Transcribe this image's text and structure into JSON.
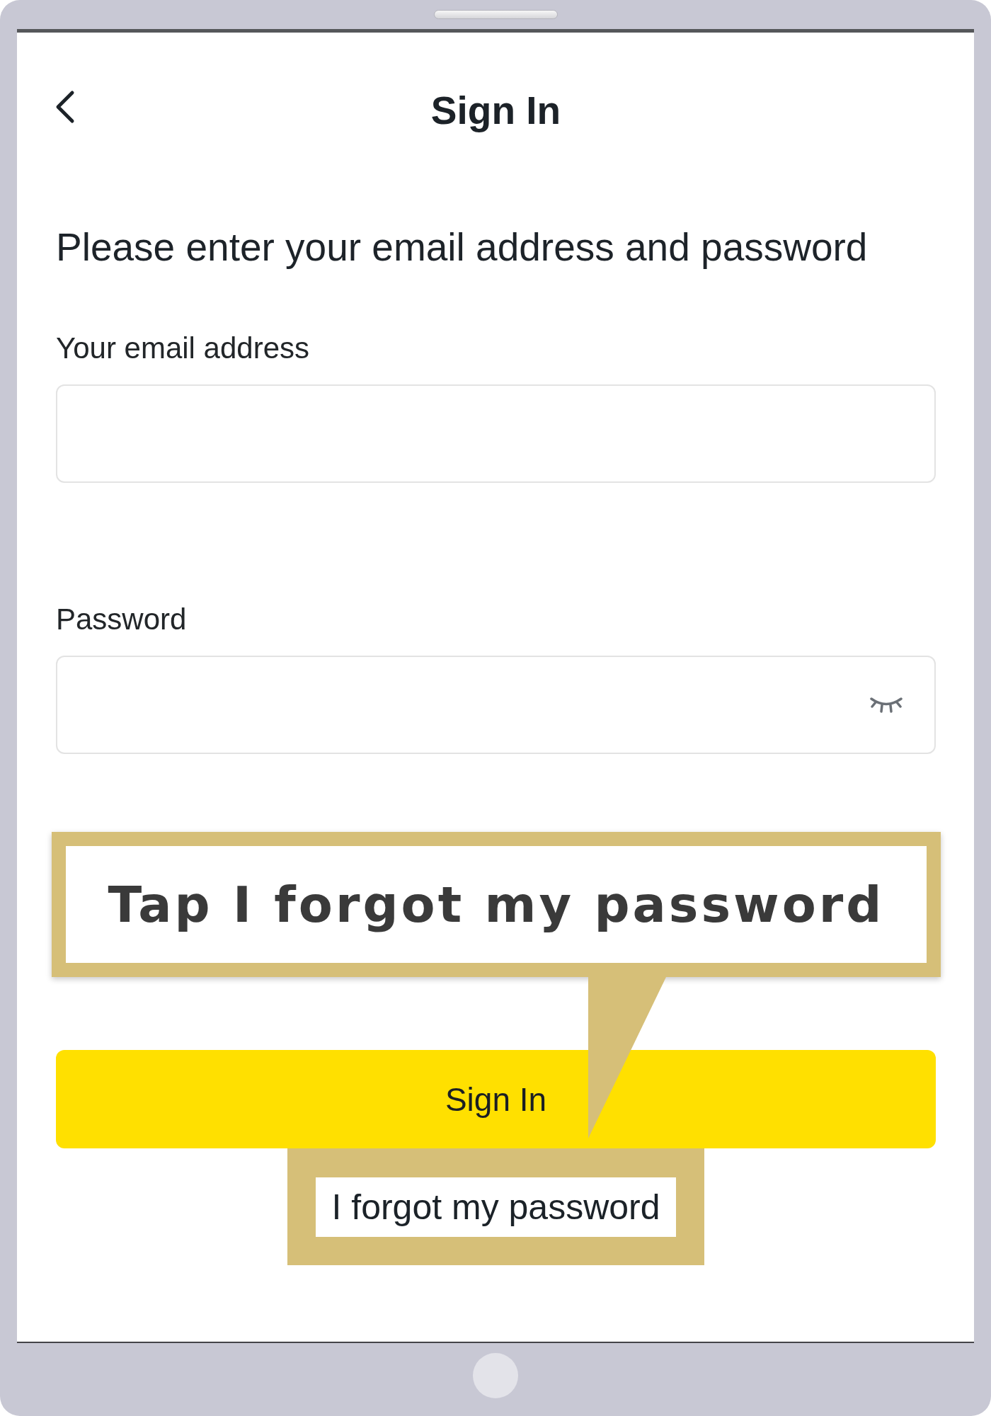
{
  "header": {
    "title": "Sign In"
  },
  "instruction": "Please enter your email address and password",
  "fields": [
    {
      "kind": "email",
      "label": "Your email address"
    },
    {
      "kind": "password",
      "label": "Password"
    }
  ],
  "callout": {
    "text": "Tap I forgot my password"
  },
  "sign_in_button": {
    "label": "Sign In"
  },
  "forgot_link": {
    "label": "I forgot my password",
    "highlighted": true
  }
}
